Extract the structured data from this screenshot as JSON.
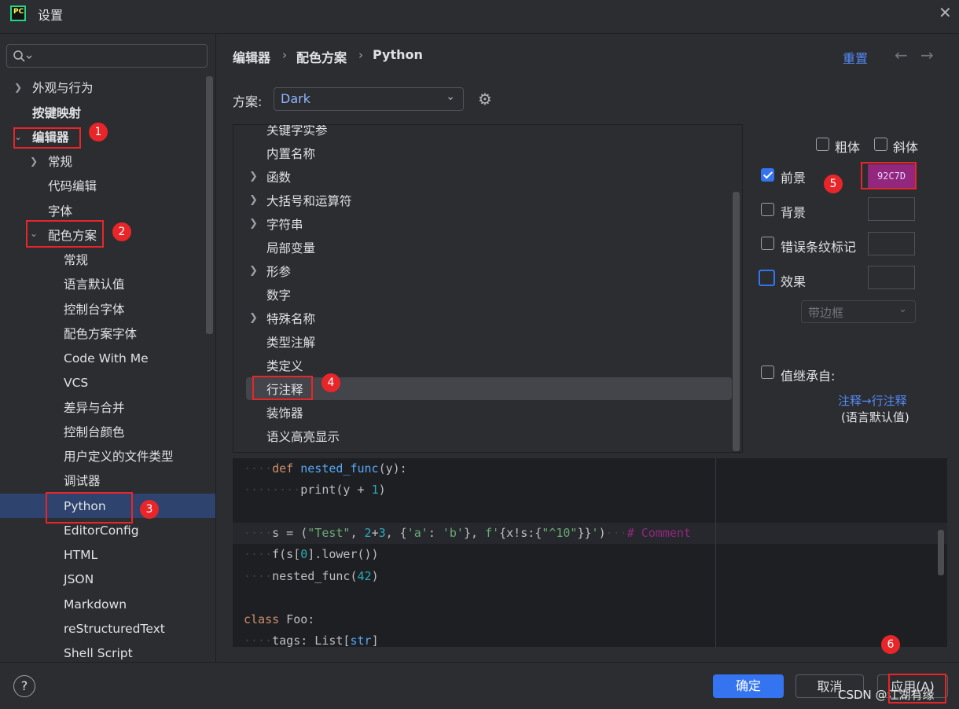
{
  "window": {
    "title": "设置",
    "app_icon_text": "PC",
    "close_glyph": "✕"
  },
  "sidebar": {
    "search_placeholder": "",
    "items": [
      {
        "label": "外观与行为"
      },
      {
        "label": "按键映射"
      },
      {
        "label": "编辑器"
      },
      {
        "label": "常规"
      },
      {
        "label": "代码编辑"
      },
      {
        "label": "字体"
      },
      {
        "label": "配色方案"
      },
      {
        "label": "常规"
      },
      {
        "label": "语言默认值"
      },
      {
        "label": "控制台字体"
      },
      {
        "label": "配色方案字体"
      },
      {
        "label": "Code With Me"
      },
      {
        "label": "VCS"
      },
      {
        "label": "差异与合并"
      },
      {
        "label": "控制台颜色"
      },
      {
        "label": "用户定义的文件类型"
      },
      {
        "label": "调试器"
      },
      {
        "label": "Python"
      },
      {
        "label": "EditorConfig"
      },
      {
        "label": "HTML"
      },
      {
        "label": "JSON"
      },
      {
        "label": "Markdown"
      },
      {
        "label": "reStructuredText"
      },
      {
        "label": "Shell Script"
      }
    ]
  },
  "breadcrumb": [
    "编辑器",
    "配色方案",
    "Python"
  ],
  "header": {
    "reset_label": "重置",
    "back_glyph": "←",
    "forward_glyph": "→"
  },
  "scheme": {
    "label": "方案:",
    "value": "Dark"
  },
  "tree": {
    "items": [
      {
        "label": "关键字实参"
      },
      {
        "label": "内置名称"
      },
      {
        "label": "函数"
      },
      {
        "label": "大括号和运算符"
      },
      {
        "label": "字符串"
      },
      {
        "label": "局部变量"
      },
      {
        "label": "形参"
      },
      {
        "label": "数字"
      },
      {
        "label": "特殊名称"
      },
      {
        "label": "类型注解"
      },
      {
        "label": "类定义"
      },
      {
        "label": "行注释"
      },
      {
        "label": "装饰器"
      },
      {
        "label": "语义高亮显示"
      }
    ],
    "selected": "行注释"
  },
  "options": {
    "bold": {
      "label": "粗体",
      "checked": false
    },
    "italic": {
      "label": "斜体",
      "checked": false
    },
    "foreground": {
      "label": "前景",
      "checked": true,
      "color": "92C7D"
    },
    "background": {
      "label": "背景",
      "checked": false
    },
    "error_stripe": {
      "label": "错误条纹标记",
      "checked": false
    },
    "effects": {
      "label": "效果",
      "checked": false
    },
    "effect_type": "带边框",
    "inherit": {
      "label": "值继承自:",
      "checked": false,
      "link": "注释→行注释",
      "sub": "(语言默认值)"
    }
  },
  "code_preview": {
    "lines": [
      "    def nested_func(y):",
      "        print(y + 1)",
      "",
      "    s = (\"Test\", 2+3, {'a': 'b'}, f'{x!s:{\"^10\"}}')   # Comment",
      "    f(s[0].lower())",
      "    nested_func(42)",
      "",
      "class Foo:",
      "    tags: List[str]"
    ]
  },
  "footer": {
    "ok": "确定",
    "cancel": "取消",
    "apply": "应用(A)",
    "help": "?"
  },
  "annotations": [
    "1",
    "2",
    "3",
    "4",
    "5",
    "6"
  ],
  "watermark": "CSDN @江湖有缘",
  "colors": {
    "accent": "#3574f0",
    "selection": "#2e436e",
    "annotation": "#e8262a",
    "comment": "#92277d"
  }
}
